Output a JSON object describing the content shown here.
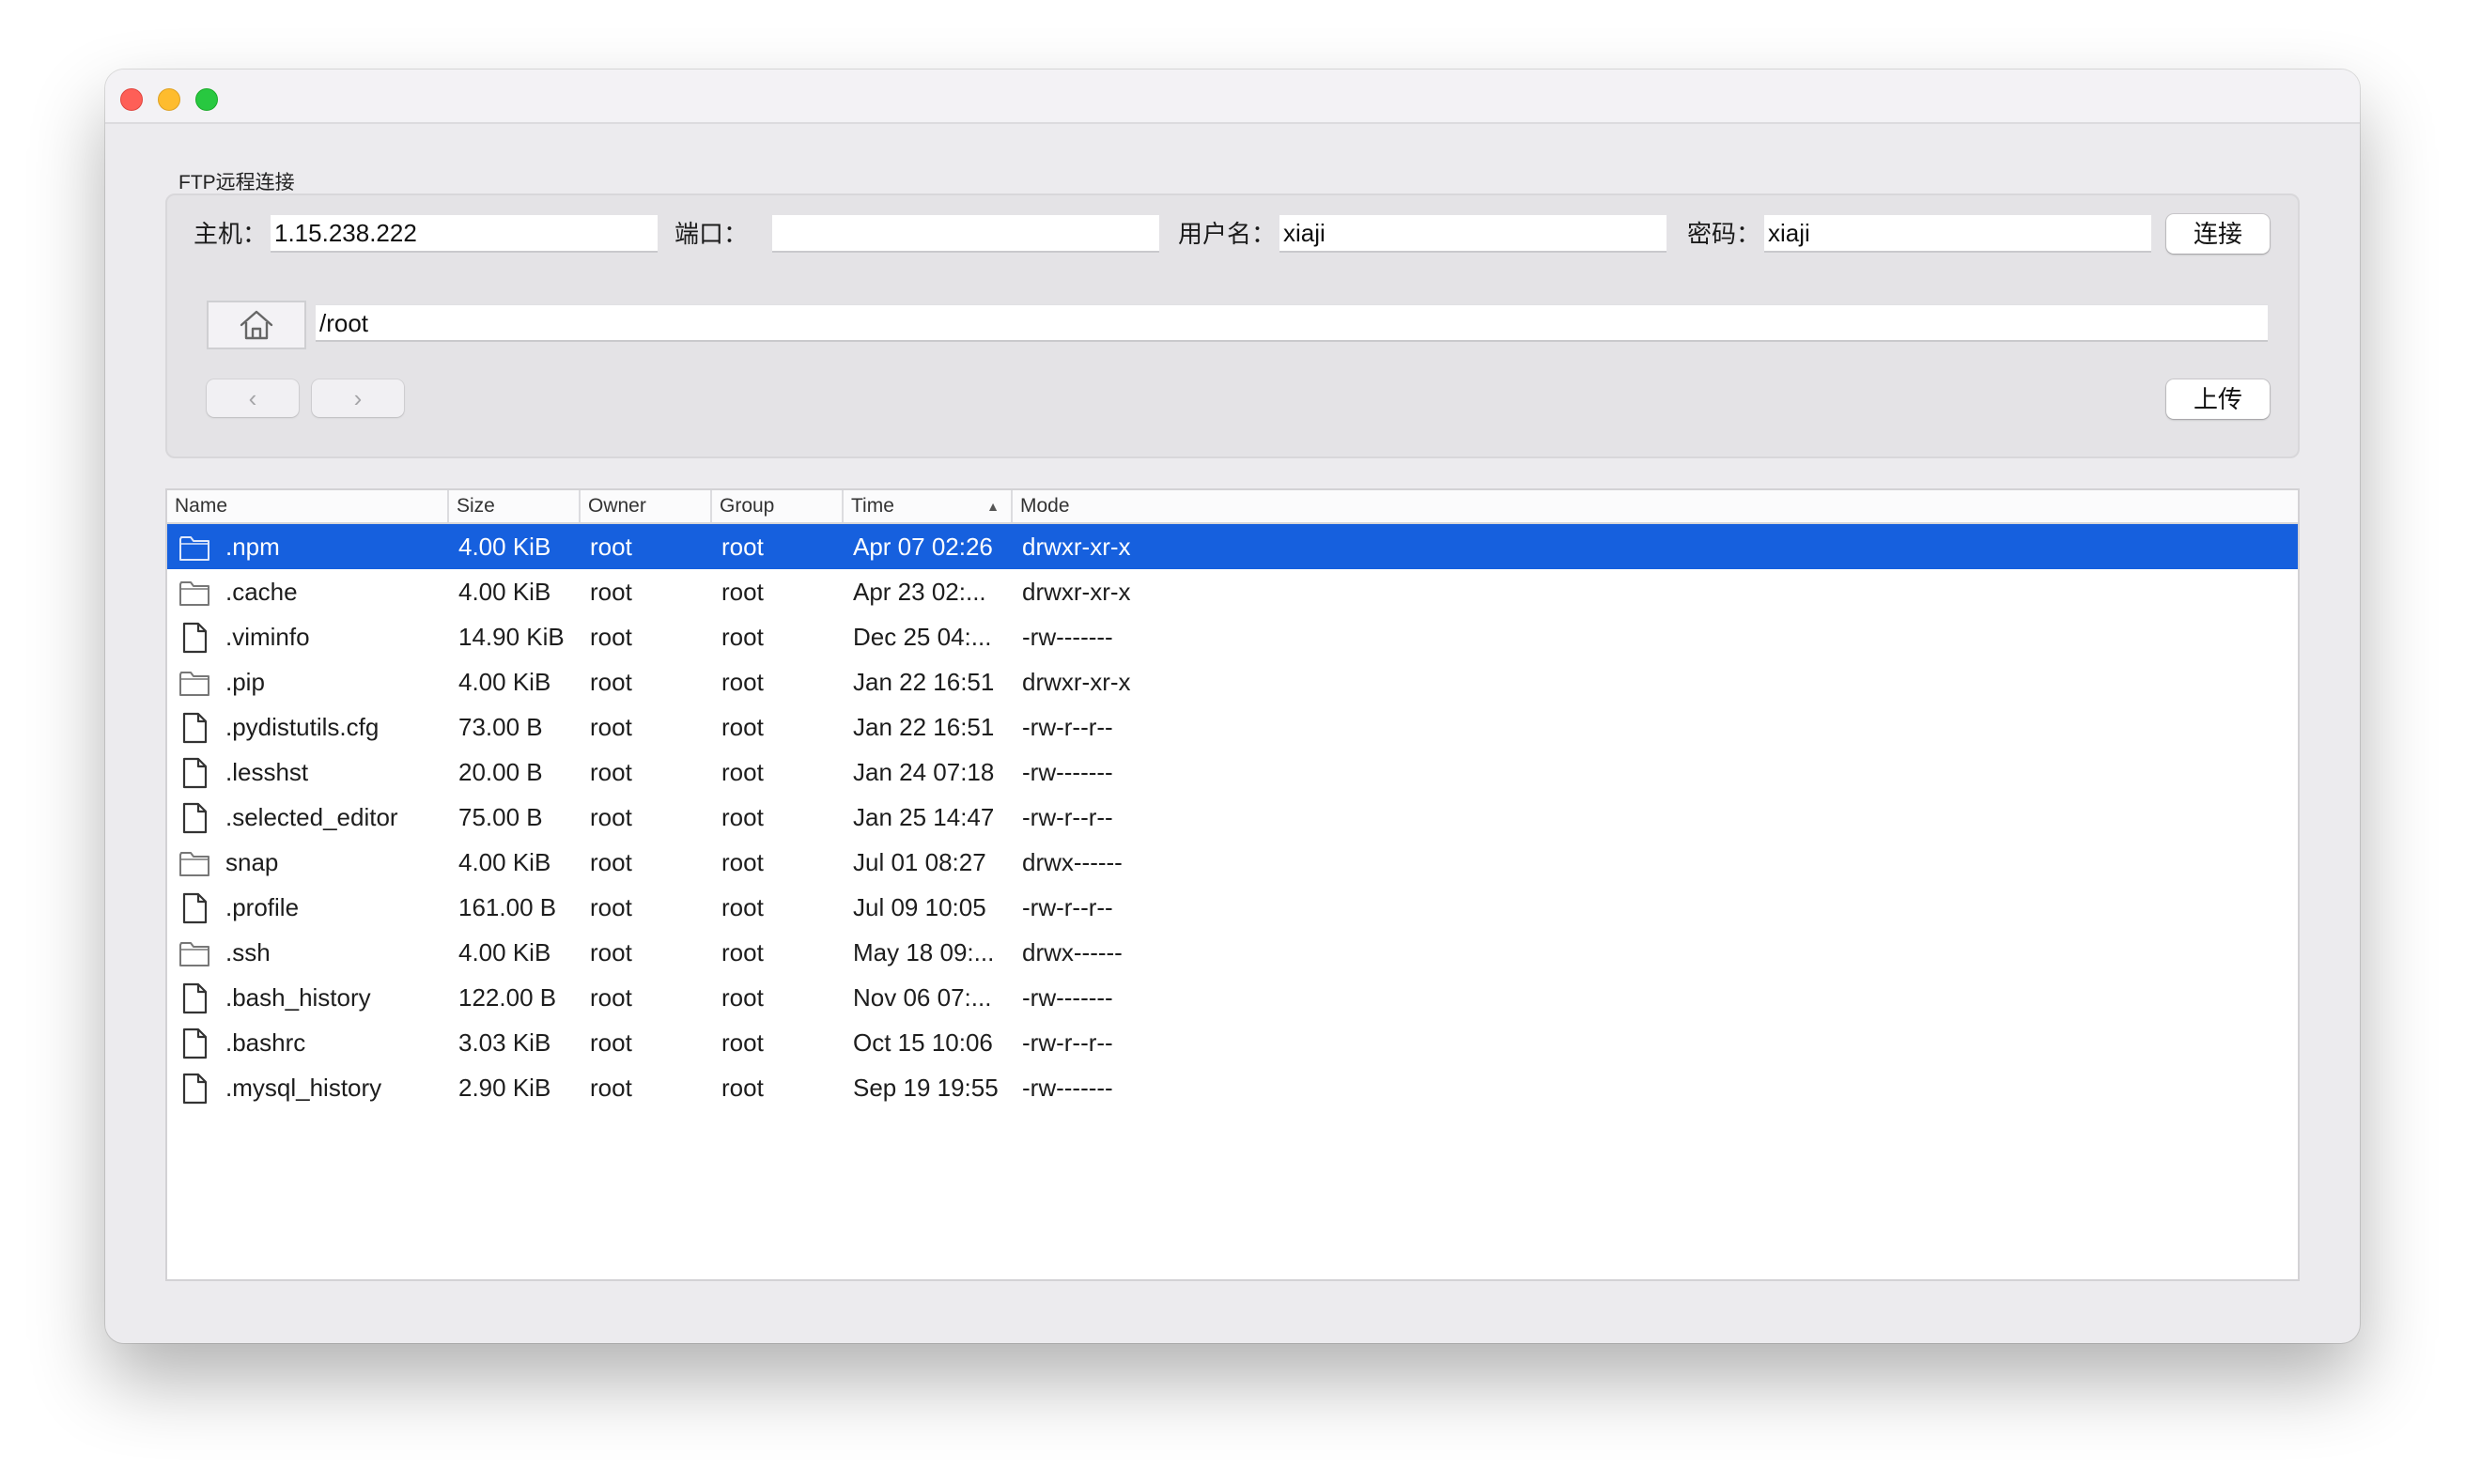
{
  "group_title": "FTP远程连接",
  "connection": {
    "host_label": "主机：",
    "host_value": "1.15.238.222",
    "port_label": "端口：",
    "port_value": "",
    "user_label": "用户名：",
    "user_value": "xiaji",
    "password_label": "密码：",
    "password_value": "xiaji",
    "connect_button": "连接"
  },
  "path": {
    "home_icon": "home-icon",
    "value": "/root"
  },
  "nav": {
    "back_glyph": "‹",
    "forward_glyph": "›",
    "upload_button": "上传"
  },
  "table": {
    "headers": {
      "name": "Name",
      "size": "Size",
      "owner": "Owner",
      "group": "Group",
      "time": "Time",
      "mode": "Mode"
    },
    "sort_glyph": "▲",
    "selected_color": "#1660de",
    "rows": [
      {
        "type": "folder",
        "name": ".npm",
        "size": "4.00 KiB",
        "owner": "root",
        "group": "root",
        "time": "Apr 07 02:26",
        "mode": "drwxr-xr-x"
      },
      {
        "type": "folder",
        "name": ".cache",
        "size": "4.00 KiB",
        "owner": "root",
        "group": "root",
        "time": "Apr 23 02:...",
        "mode": "drwxr-xr-x"
      },
      {
        "type": "file",
        "name": ".viminfo",
        "size": "14.90 KiB",
        "owner": "root",
        "group": "root",
        "time": "Dec 25 04:...",
        "mode": "-rw-------"
      },
      {
        "type": "folder",
        "name": ".pip",
        "size": "4.00 KiB",
        "owner": "root",
        "group": "root",
        "time": "Jan 22 16:51",
        "mode": "drwxr-xr-x"
      },
      {
        "type": "file",
        "name": ".pydistutils.cfg",
        "size": "73.00 B",
        "owner": "root",
        "group": "root",
        "time": "Jan 22 16:51",
        "mode": "-rw-r--r--"
      },
      {
        "type": "file",
        "name": ".lesshst",
        "size": "20.00 B",
        "owner": "root",
        "group": "root",
        "time": "Jan 24 07:18",
        "mode": "-rw-------"
      },
      {
        "type": "file",
        "name": ".selected_editor",
        "size": "75.00 B",
        "owner": "root",
        "group": "root",
        "time": "Jan 25 14:47",
        "mode": "-rw-r--r--"
      },
      {
        "type": "folder",
        "name": "snap",
        "size": "4.00 KiB",
        "owner": "root",
        "group": "root",
        "time": "Jul 01 08:27",
        "mode": "drwx------"
      },
      {
        "type": "file",
        "name": ".profile",
        "size": "161.00 B",
        "owner": "root",
        "group": "root",
        "time": "Jul 09 10:05",
        "mode": "-rw-r--r--"
      },
      {
        "type": "folder",
        "name": ".ssh",
        "size": "4.00 KiB",
        "owner": "root",
        "group": "root",
        "time": "May 18 09:...",
        "mode": "drwx------"
      },
      {
        "type": "file",
        "name": ".bash_history",
        "size": "122.00 B",
        "owner": "root",
        "group": "root",
        "time": "Nov 06 07:...",
        "mode": "-rw-------"
      },
      {
        "type": "file",
        "name": ".bashrc",
        "size": "3.03 KiB",
        "owner": "root",
        "group": "root",
        "time": "Oct 15 10:06",
        "mode": "-rw-r--r--"
      },
      {
        "type": "file",
        "name": ".mysql_history",
        "size": "2.90 KiB",
        "owner": "root",
        "group": "root",
        "time": "Sep 19 19:55",
        "mode": "-rw-------"
      }
    ]
  }
}
